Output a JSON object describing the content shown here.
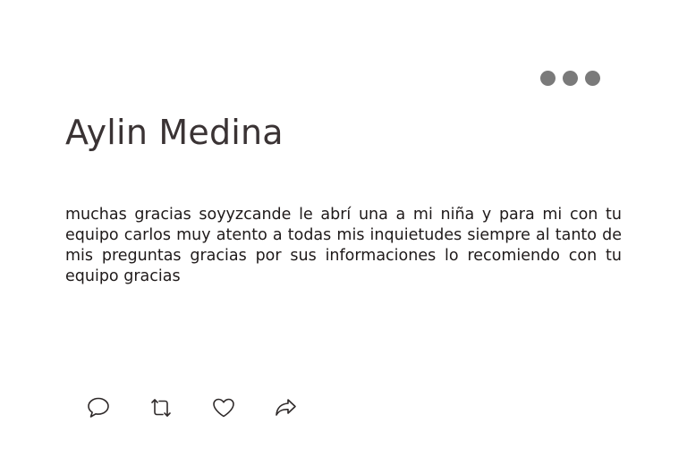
{
  "review_card": {
    "author_name": "Aylin Medina",
    "review_text": "muchas gracias soyyzcande le abrí una a mi niña y para mi con tu equipo carlos muy atento a todas mis inquietudes siempre al tanto de mis preguntas gracias por sus informaciones lo recomiendo con tu equipo gracias",
    "more_menu_icon": "ellipsis-icon",
    "actions": [
      {
        "icon": "comment-icon"
      },
      {
        "icon": "retweet-icon"
      },
      {
        "icon": "heart-icon"
      },
      {
        "icon": "share-icon"
      }
    ]
  }
}
